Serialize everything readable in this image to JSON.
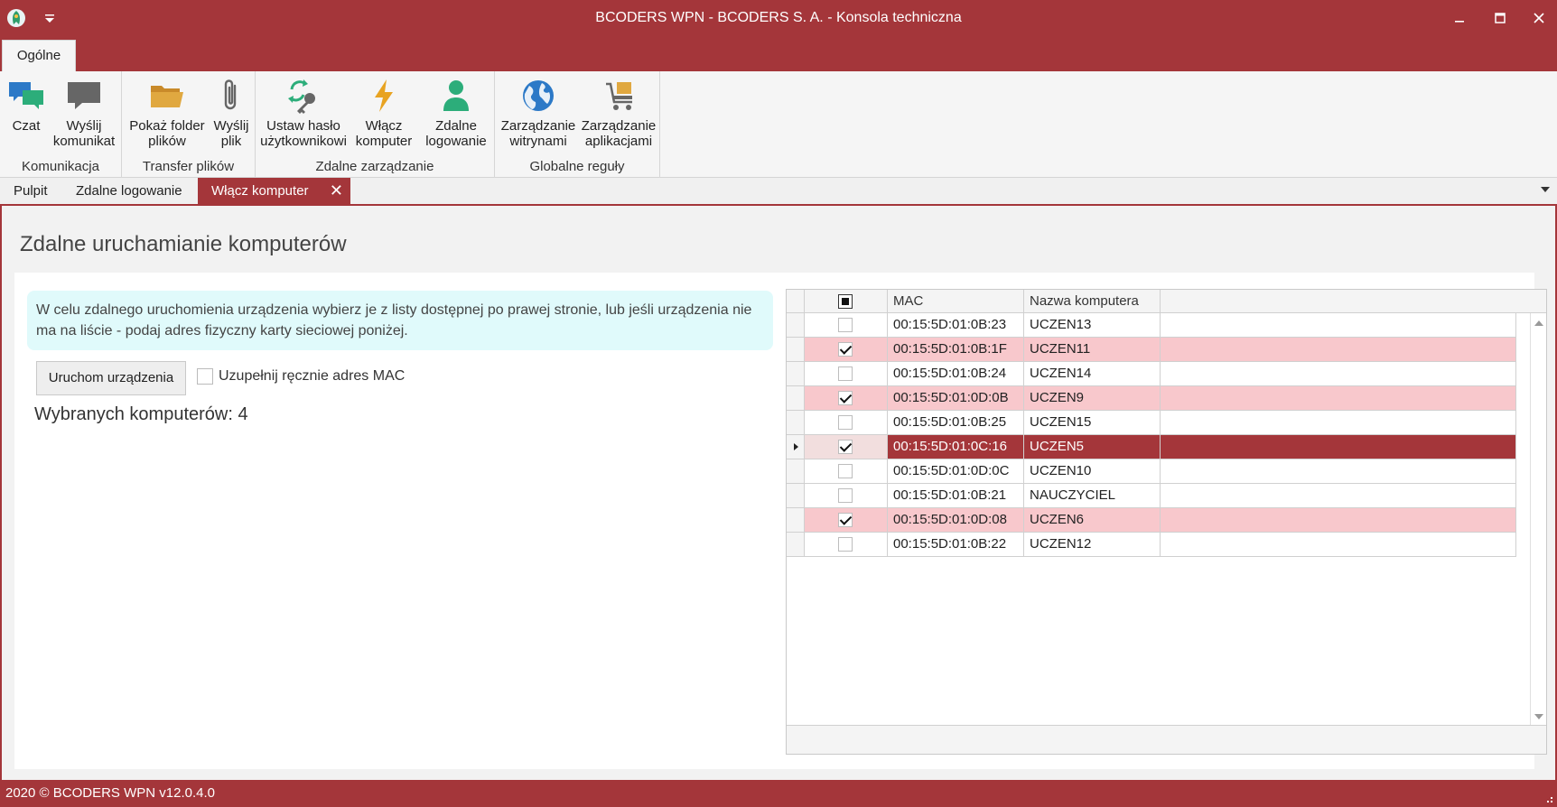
{
  "window": {
    "title": "BCODERS WPN - BCODERS S. A. - Konsola techniczna",
    "accent": "#a4363a"
  },
  "ribbon": {
    "tab": "Ogólne",
    "groups": {
      "komunikacja": {
        "label": "Komunikacja",
        "czat": "Czat",
        "wyslij_komunikat": [
          "Wyślij",
          "komunikat"
        ]
      },
      "transfer": {
        "label": "Transfer plików",
        "pokaz_folder": [
          "Pokaż folder",
          "plików"
        ],
        "wyslij_plik": [
          "Wyślij",
          "plik"
        ]
      },
      "zdalne": {
        "label": "Zdalne zarządzanie",
        "ustaw_haslo": [
          "Ustaw hasło",
          "użytkownikowi"
        ],
        "wlacz_komputer": [
          "Włącz",
          "komputer"
        ],
        "zdalne_logowanie": [
          "Zdalne",
          "logowanie"
        ]
      },
      "globalne": {
        "label": "Globalne reguły",
        "witryny": [
          "Zarządzanie",
          "witrynami"
        ],
        "aplikacje": [
          "Zarządzanie",
          "aplikacjami"
        ]
      }
    },
    "icons": [
      "chat-icon",
      "message-icon",
      "folder-open-icon",
      "paperclip-icon",
      "key-refresh-icon",
      "lightning-icon",
      "user-icon",
      "globe-icon",
      "cart-icon"
    ]
  },
  "doc_tabs": {
    "pulpit": "Pulpit",
    "zdalne_logowanie": "Zdalne logowanie",
    "wlacz_komputer": "Włącz komputer"
  },
  "page": {
    "title": "Zdalne uruchamianie komputerów",
    "info": "W celu zdalnego uruchomienia urządzenia wybierz je z listy dostępnej po prawej stronie, lub jeśli urządzenia nie ma na liście - podaj adres fizyczny karty sieciowej poniżej.",
    "start_button": "Uruchom urządzenia",
    "manual_mac_label": "Uzupełnij ręcznie adres MAC",
    "selected_count": "Wybranych komputerów: 4"
  },
  "grid": {
    "columns": {
      "mac": "MAC",
      "name": "Nazwa komputera"
    },
    "rows": [
      {
        "checked": false,
        "mac": "00:15:5D:01:0B:23",
        "name": "UCZEN13"
      },
      {
        "checked": true,
        "mac": "00:15:5D:01:0B:1F",
        "name": "UCZEN11"
      },
      {
        "checked": false,
        "mac": "00:15:5D:01:0B:24",
        "name": "UCZEN14"
      },
      {
        "checked": true,
        "mac": "00:15:5D:01:0D:0B",
        "name": "UCZEN9"
      },
      {
        "checked": false,
        "mac": "00:15:5D:01:0B:25",
        "name": "UCZEN15"
      },
      {
        "checked": true,
        "mac": "00:15:5D:01:0C:16",
        "name": "UCZEN5",
        "current": true
      },
      {
        "checked": false,
        "mac": "00:15:5D:01:0D:0C",
        "name": "UCZEN10"
      },
      {
        "checked": false,
        "mac": "00:15:5D:01:0B:21",
        "name": "NAUCZYCIEL"
      },
      {
        "checked": true,
        "mac": "00:15:5D:01:0D:08",
        "name": "UCZEN6"
      },
      {
        "checked": false,
        "mac": "00:15:5D:01:0B:22",
        "name": "UCZEN12"
      }
    ]
  },
  "status": {
    "text": "2020 ©  BCODERS WPN v12.0.4.0"
  }
}
